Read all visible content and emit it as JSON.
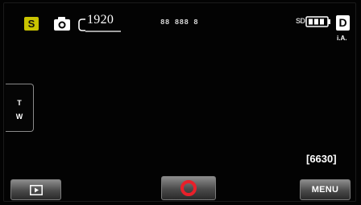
{
  "status_bar": {
    "scene_mode": "S",
    "resolution": "1920",
    "center_text": "88 888 8",
    "storage": "SD",
    "format": "D",
    "auto_mode": "i.A."
  },
  "zoom": {
    "tele_label": "T",
    "wide_label": "W"
  },
  "remaining_shots": "[6630]",
  "buttons": {
    "menu_label": "MENU"
  },
  "colors": {
    "scene_badge": "#c9c400",
    "record_button": "#e8202a"
  },
  "icons": {
    "camera": "camera-icon",
    "battery": "battery-icon",
    "play": "play-icon",
    "record": "record-icon"
  }
}
